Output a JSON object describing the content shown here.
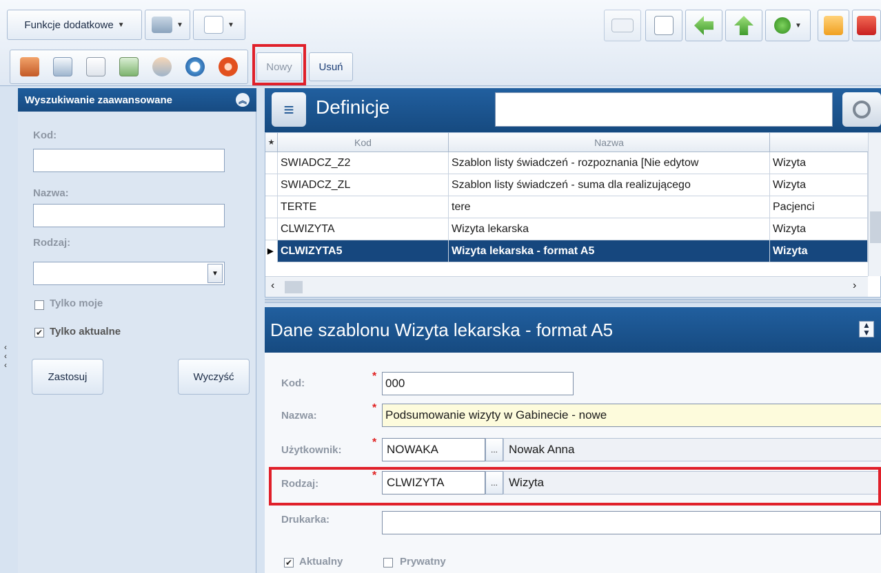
{
  "toolbar": {
    "funkcje_label": "Funkcje dodatkowe",
    "nowy_label": "Nowy",
    "usun_label": "Usuń",
    "nav_icons": [
      "home-icon",
      "window-icon",
      "notepad-icon",
      "document-icon",
      "users-icon",
      "refresh-icon",
      "settings-icon"
    ],
    "right_icons": [
      "mail-icon",
      "fax-icon",
      "back-arrow-icon",
      "up-arrow-icon",
      "help-icon",
      "lock-icon",
      "power-icon"
    ]
  },
  "search_panel": {
    "title": "Wyszukiwanie zaawansowane",
    "kod_label": "Kod:",
    "nazwa_label": "Nazwa:",
    "rodzaj_label": "Rodzaj:",
    "tylko_moje_label": "Tylko moje",
    "tylko_moje_checked": false,
    "tylko_aktualne_label": "Tylko aktualne",
    "tylko_aktualne_checked": true,
    "zastosuj_label": "Zastosuj",
    "wyczysc_label": "Wyczyść"
  },
  "definicje": {
    "title": "Definicje",
    "columns": [
      "Kod",
      "Nazwa"
    ],
    "rows": [
      {
        "kod": "SWIADCZ_Z2",
        "nazwa": "Szablon listy świadczeń - rozpoznania [Nie edytow",
        "rodzaj": "Wizyta"
      },
      {
        "kod": "SWIADCZ_ZL",
        "nazwa": "Szablon listy świadczeń - suma dla realizującego",
        "rodzaj": "Wizyta"
      },
      {
        "kod": "TERTE",
        "nazwa": "tere",
        "rodzaj": "Pacjenci"
      },
      {
        "kod": "CLWIZYTA",
        "nazwa": "Wizyta lekarska",
        "rodzaj": "Wizyta"
      },
      {
        "kod": "CLWIZYTA5",
        "nazwa": "Wizyta lekarska - format A5",
        "rodzaj": "Wizyta"
      }
    ],
    "selected_index": 4
  },
  "details": {
    "title": "Dane szablonu Wizyta lekarska - format A5",
    "kod_label": "Kod:",
    "kod_value": "000",
    "nazwa_label": "Nazwa:",
    "nazwa_value": "Podsumowanie wizyty w Gabinecie - nowe",
    "uzytkownik_label": "Użytkownik:",
    "uzytkownik_code": "NOWAKA",
    "uzytkownik_name": "Nowak Anna",
    "rodzaj_label": "Rodzaj:",
    "rodzaj_code": "CLWIZYTA",
    "rodzaj_name": "Wizyta",
    "drukarka_label": "Drukarka:",
    "aktualny_label": "Aktualny",
    "aktualny_checked": true,
    "prywatny_label": "Prywatny",
    "prywatny_checked": false,
    "required_mark": "*",
    "dots": "..."
  },
  "colors": {
    "header_blue": "#1a5490",
    "selected_row": "#16477e",
    "highlight": "#e0202a",
    "yellow_field": "#fdfbdc"
  }
}
